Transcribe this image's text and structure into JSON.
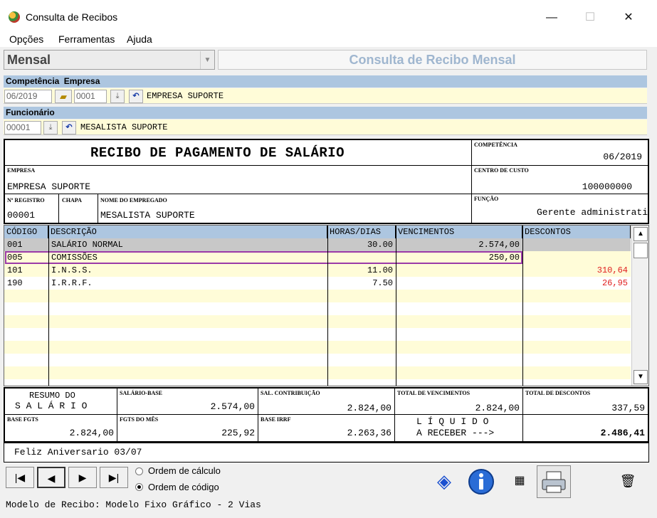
{
  "window": {
    "title": "Consulta de Recibos",
    "controls": {
      "minimize": "—",
      "maximize": "☐",
      "close": "✕"
    }
  },
  "menu": {
    "items": [
      "Opções",
      "Ferramentas",
      "Ajuda"
    ]
  },
  "mode_combo": {
    "value": "Mensal"
  },
  "banner": "Consulta de Recibo Mensal",
  "filters": {
    "competencia_label": "Competência",
    "empresa_label": "Empresa",
    "competencia_value": "06/2019",
    "empresa_code": "0001",
    "empresa_name": "EMPRESA SUPORTE",
    "funcionario_label": "Funcionário",
    "funcionario_code": "00001",
    "funcionario_name": "MESALISTA SUPORTE"
  },
  "receipt": {
    "title": "RECIBO DE PAGAMENTO DE SALÁRIO",
    "competencia_label": "COMPETÊNCIA",
    "competencia": "06/2019",
    "empresa_label": "EMPRESA",
    "empresa": "EMPRESA SUPORTE",
    "centro_custo_label": "CENTRO DE CUSTO",
    "centro_custo": "100000000",
    "registro_label": "Nº REGISTRO",
    "registro": "00001",
    "chapa_label": "CHAPA",
    "chapa": "",
    "nome_label": "NOME DO EMPREGADO",
    "nome": "MESALISTA SUPORTE",
    "funcao_label": "FUNÇÃO",
    "funcao": "Gerente administrati"
  },
  "grid": {
    "headers": [
      "CÓDIGO",
      "DESCRIÇÃO",
      "HORAS/DIAS",
      "VENCIMENTOS",
      "DESCONTOS"
    ],
    "rows": [
      {
        "codigo": "001",
        "descricao": "SALÁRIO NORMAL",
        "horas": "30.00",
        "vencimentos": "2.574,00",
        "descontos": ""
      },
      {
        "codigo": "005",
        "descricao": "COMISSÕES",
        "horas": "",
        "vencimentos": "250,00",
        "descontos": ""
      },
      {
        "codigo": "101",
        "descricao": "I.N.S.S.",
        "horas": "11.00",
        "vencimentos": "",
        "descontos": "310,64"
      },
      {
        "codigo": "190",
        "descricao": "I.R.R.F.",
        "horas": "7.50",
        "vencimentos": "",
        "descontos": "26,95"
      }
    ],
    "selected_row_index": 1,
    "scroll_up": "▲",
    "scroll_down": "▼"
  },
  "summary": {
    "resumo_l1": "RESUMO DO",
    "resumo_l2": "S A L Á R I O",
    "salario_base_label": "SALÁRIO-BASE",
    "salario_base": "2.574,00",
    "sal_contrib_label": "SAL. CONTRIBUIÇÃO",
    "sal_contrib": "2.824,00",
    "total_venc_label": "TOTAL DE VENCIMENTOS",
    "total_venc": "2.824,00",
    "total_desc_label": "TOTAL DE DESCONTOS",
    "total_desc": "337,59",
    "base_fgts_label": "BASE FGTS",
    "base_fgts": "2.824,00",
    "fgts_mes_label": "FGTS DO MÊS",
    "fgts_mes": "225,92",
    "base_irrf_label": "BASE IRRF",
    "base_irrf": "2.263,36",
    "liquido_l1": "L Í Q U I D O",
    "liquido_l2": "A RECEBER --->",
    "liquido": "2.486,41"
  },
  "message": "Feliz Aniversario 03/07",
  "nav": {
    "first": "|◀",
    "prev": "◀",
    "next": "▶",
    "last": "▶|"
  },
  "order": {
    "calc_label": "Ordem de cálculo",
    "code_label": "Ordem de código",
    "selected": "code"
  },
  "status": "Modelo de Recibo: Modelo Fixo Gráfico - 2 Vias",
  "colors": {
    "header_blue": "#adc6e0",
    "row_stripe": "#fffcd8",
    "selected_border": "#9b3aa8",
    "negative_red": "#e02020"
  }
}
